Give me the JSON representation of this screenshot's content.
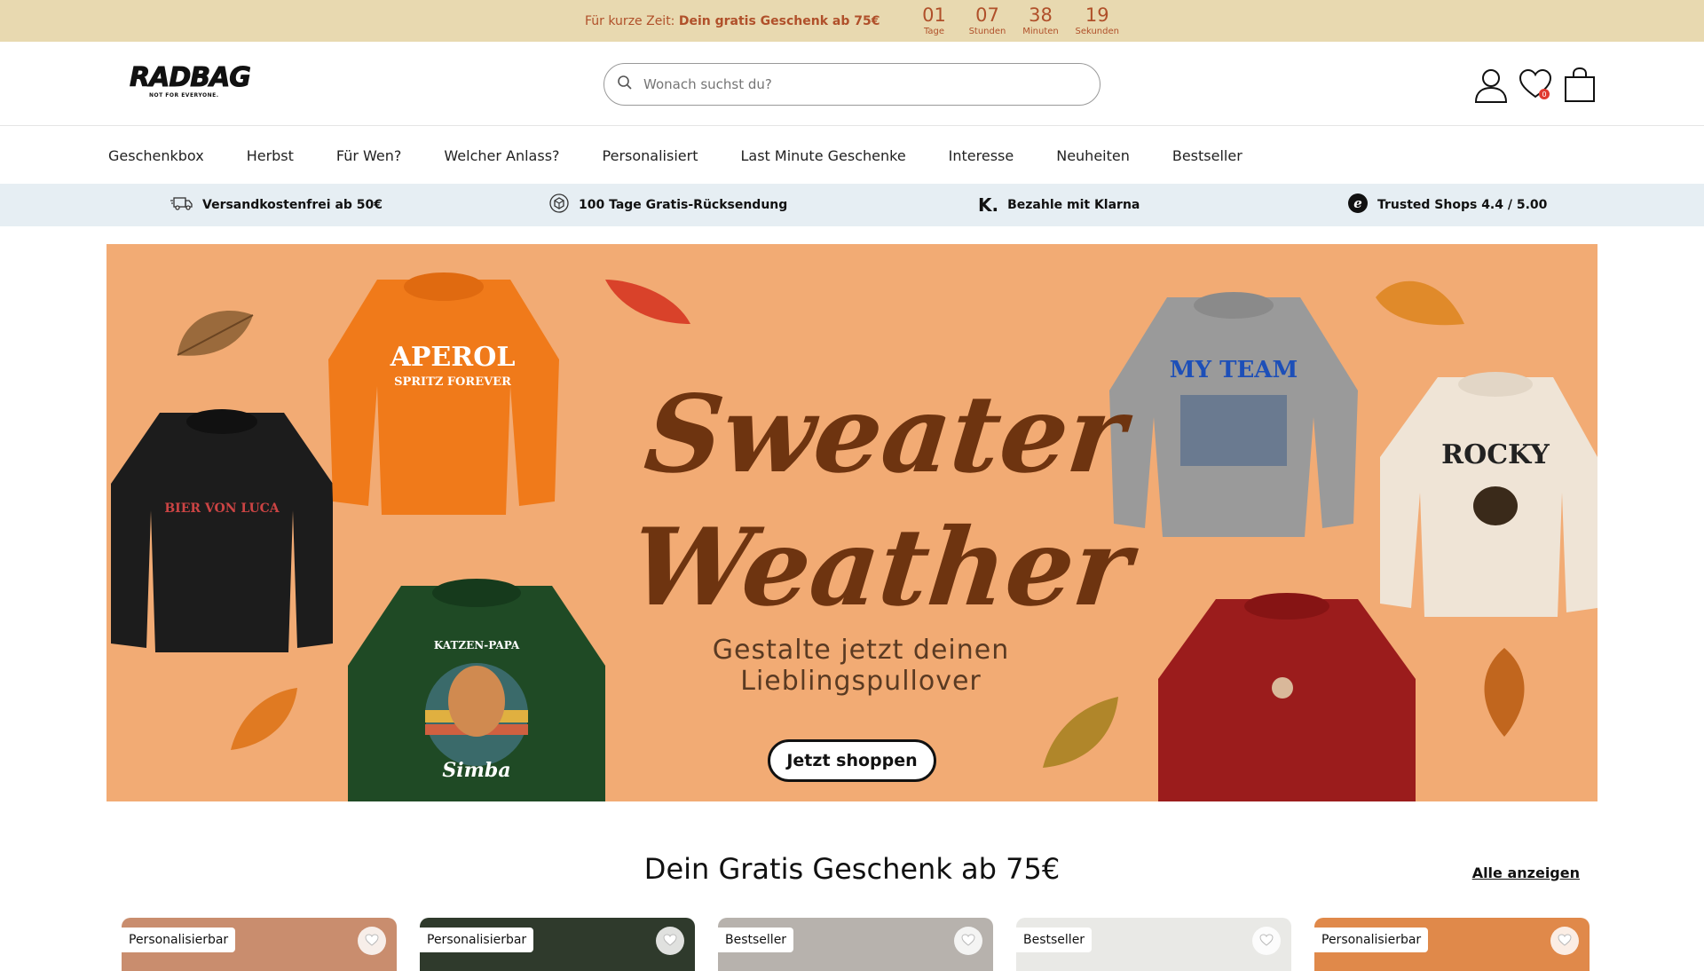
{
  "promo": {
    "prefix": "Für kurze Zeit:",
    "highlight": "Dein gratis Geschenk ab 75€",
    "timer": [
      {
        "value": "01",
        "label": "Tage"
      },
      {
        "value": "07",
        "label": "Stunden"
      },
      {
        "value": "38",
        "label": "Minuten"
      },
      {
        "value": "19",
        "label": "Sekunden"
      }
    ]
  },
  "header": {
    "logo_text": "RADBAG",
    "logo_tagline": "NOT FOR EVERYONE.",
    "search_placeholder": "Wonach suchst du?",
    "wishlist_count": "0",
    "icons": [
      "user-icon",
      "heart-icon",
      "shopping-bag-icon"
    ]
  },
  "nav": {
    "items": [
      "Geschenkbox",
      "Herbst",
      "Für Wen?",
      "Welcher Anlass?",
      "Personalisiert",
      "Last Minute Geschenke",
      "Interesse",
      "Neuheiten",
      "Bestseller"
    ]
  },
  "usp": {
    "items": [
      {
        "icon": "truck-icon",
        "label": "Versandkostenfrei ab 50€"
      },
      {
        "icon": "return-box-icon",
        "label": "100 Tage Gratis-Rücksendung"
      },
      {
        "icon": "klarna-icon",
        "label": "Bezahle mit Klarna"
      },
      {
        "icon": "trusted-shops-icon",
        "label": "Trusted Shops 4.4 / 5.00"
      }
    ]
  },
  "hero": {
    "title_line1": "Sweater",
    "title_line2": "Weather",
    "subtitle": "Gestalte jetzt deinen Lieblingspullover",
    "cta": "Jetzt shoppen",
    "sweaters": [
      {
        "text": "APEROL",
        "sub": "SPRITZ FOREVER",
        "color": "#f07a1a"
      },
      {
        "text": "BIER VON LUCA",
        "sub": "",
        "color": "#1c1c1c"
      },
      {
        "text": "KATZEN-PAPA",
        "sub": "Simba",
        "color": "#1f4a25"
      },
      {
        "text": "MY TEAM",
        "sub": "",
        "color": "#9a9a9a"
      },
      {
        "text": "ROCKY",
        "sub": "",
        "color": "#efe4d6"
      },
      {
        "text": "",
        "sub": "",
        "color": "#9b1c1c"
      }
    ]
  },
  "section": {
    "title": "Dein Gratis Geschenk ab 75€",
    "show_all": "Alle anzeigen"
  },
  "cards": [
    {
      "tag": "Personalisierbar",
      "color": "#c98d6e"
    },
    {
      "tag": "Personalisierbar",
      "color": "#2f3a2c"
    },
    {
      "tag": "Bestseller",
      "color": "#b7b2ad"
    },
    {
      "tag": "Bestseller",
      "color": "#e9e9e6"
    },
    {
      "tag": "Personalisierbar",
      "color": "#e0894a"
    }
  ]
}
